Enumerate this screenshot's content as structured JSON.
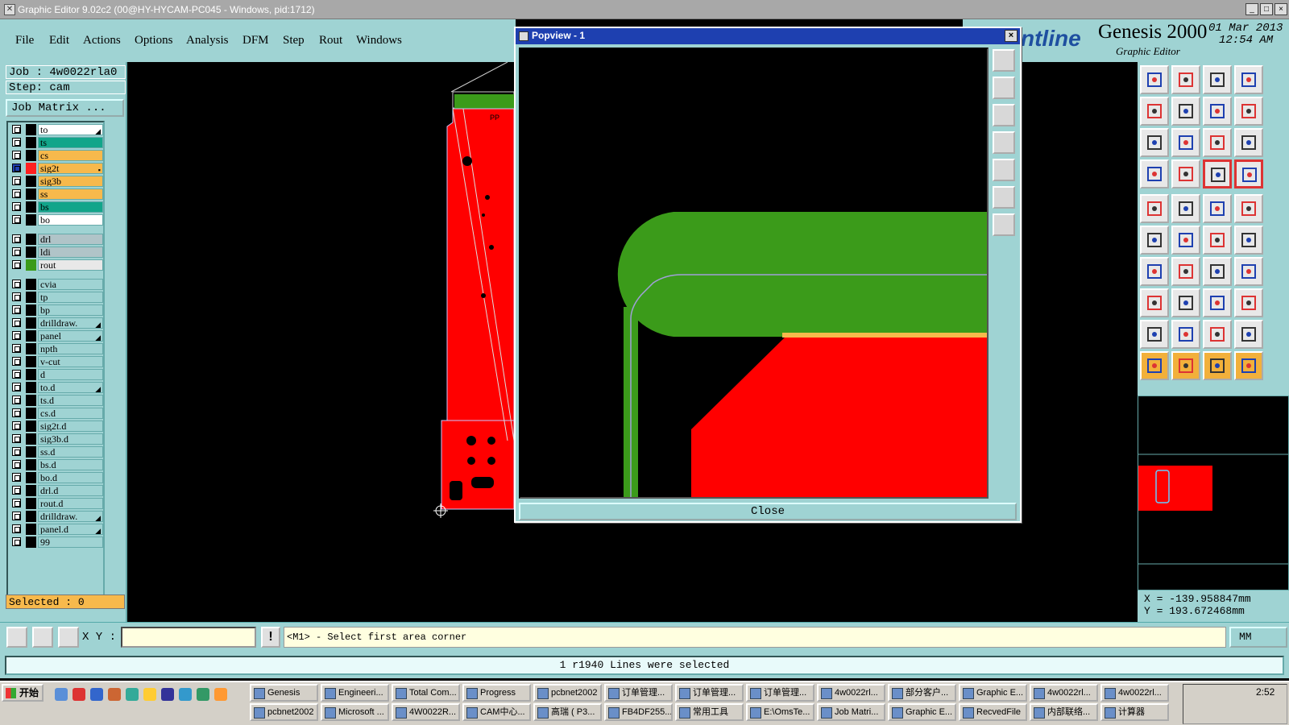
{
  "window": {
    "title": "Graphic Editor 9.02c2 (00@HY-HYCAM-PC045 - Windows, pid:1712)",
    "buttons": [
      "_",
      "□",
      "×"
    ]
  },
  "menu": [
    "File",
    "Edit",
    "Actions",
    "Options",
    "Analysis",
    "DFM",
    "Step",
    "Rout",
    "Windows"
  ],
  "brand": {
    "logo": "ntline",
    "product": "Genesis 2000",
    "subtitle": "Graphic Editor",
    "date": "01 Mar 2013",
    "time": "12:54 AM"
  },
  "job": {
    "job_line": "Job : 4w0022rla0",
    "step_line": "Step: cam",
    "matrix_button": "Job Matrix ..."
  },
  "layers": [
    {
      "name": "to",
      "color": "#ffffff",
      "swatch": "#000000",
      "mark": "◢"
    },
    {
      "name": "ts",
      "color": "#12a58a",
      "swatch": "#000000",
      "mark": ""
    },
    {
      "name": "cs",
      "color": "#f7b94c",
      "swatch": "#000000",
      "mark": ""
    },
    {
      "name": "sig2t",
      "color": "#f7b94c",
      "swatch": "#ff2020",
      "mark": "▪",
      "active": true
    },
    {
      "name": "sig3b",
      "color": "#f7b94c",
      "swatch": "#000000",
      "mark": ""
    },
    {
      "name": "ss",
      "color": "#f7b94c",
      "swatch": "#000000",
      "mark": ""
    },
    {
      "name": "bs",
      "color": "#12a58a",
      "swatch": "#000000",
      "mark": ""
    },
    {
      "name": "bo",
      "color": "#ffffff",
      "swatch": "#000000",
      "mark": ""
    },
    {
      "name": "drl",
      "color": "#b0c4c8",
      "swatch": "#000000",
      "mark": ""
    },
    {
      "name": "ldi",
      "color": "#b0c4c8",
      "swatch": "#000000",
      "mark": ""
    },
    {
      "name": "rout",
      "color": "#e8e8e8",
      "swatch": "#3b9b1a",
      "mark": ""
    },
    {
      "name": "cvia",
      "color": "#9fd3d3",
      "swatch": "#000000",
      "mark": ""
    },
    {
      "name": "tp",
      "color": "#9fd3d3",
      "swatch": "#000000",
      "mark": ""
    },
    {
      "name": "bp",
      "color": "#9fd3d3",
      "swatch": "#000000",
      "mark": ""
    },
    {
      "name": "drilldraw.",
      "color": "#9fd3d3",
      "swatch": "#000000",
      "mark": "◢"
    },
    {
      "name": "panel",
      "color": "#9fd3d3",
      "swatch": "#000000",
      "mark": "◢"
    },
    {
      "name": "npth",
      "color": "#9fd3d3",
      "swatch": "#000000",
      "mark": ""
    },
    {
      "name": "v-cut",
      "color": "#9fd3d3",
      "swatch": "#000000",
      "mark": ""
    },
    {
      "name": "d",
      "color": "#9fd3d3",
      "swatch": "#000000",
      "mark": ""
    },
    {
      "name": "to.d",
      "color": "#9fd3d3",
      "swatch": "#000000",
      "mark": "◢"
    },
    {
      "name": "ts.d",
      "color": "#9fd3d3",
      "swatch": "#000000",
      "mark": ""
    },
    {
      "name": "cs.d",
      "color": "#9fd3d3",
      "swatch": "#000000",
      "mark": ""
    },
    {
      "name": "sig2t.d",
      "color": "#9fd3d3",
      "swatch": "#000000",
      "mark": ""
    },
    {
      "name": "sig3b.d",
      "color": "#9fd3d3",
      "swatch": "#000000",
      "mark": ""
    },
    {
      "name": "ss.d",
      "color": "#9fd3d3",
      "swatch": "#000000",
      "mark": ""
    },
    {
      "name": "bs.d",
      "color": "#9fd3d3",
      "swatch": "#000000",
      "mark": ""
    },
    {
      "name": "bo.d",
      "color": "#9fd3d3",
      "swatch": "#000000",
      "mark": ""
    },
    {
      "name": "drl.d",
      "color": "#9fd3d3",
      "swatch": "#000000",
      "mark": ""
    },
    {
      "name": "rout.d",
      "color": "#9fd3d3",
      "swatch": "#000000",
      "mark": ""
    },
    {
      "name": "drilldraw.",
      "color": "#9fd3d3",
      "swatch": "#000000",
      "mark": "◢"
    },
    {
      "name": "panel.d",
      "color": "#9fd3d3",
      "swatch": "#000000",
      "mark": "◢"
    },
    {
      "name": "99",
      "color": "#9fd3d3",
      "swatch": "#000000",
      "mark": ""
    }
  ],
  "selected": "Selected : 0",
  "popview": {
    "title": "Popview - 1",
    "close_label": "Close"
  },
  "coords": {
    "x": "X = -139.958847mm",
    "y": "Y = 193.672468mm"
  },
  "cmd": {
    "xy_label": "X Y :",
    "xy_value": "",
    "warn": "!",
    "prompt": "<M1> - Select first area corner",
    "units": "MM"
  },
  "status": "1 r1940 Lines were selected",
  "colors": {
    "panel_bg": "#9fd3d3",
    "copper_red": "#ff0000",
    "green_layer": "#3b9b1a",
    "highlight_orange": "#f7b94c"
  },
  "taskbar": {
    "start": "开始",
    "row1": [
      "Genesis",
      "Engineeri...",
      "Total Com...",
      "Progress",
      "pcbnet2002",
      "订单管理...",
      "订单管理...",
      "订单管理...",
      "4w0022rl...",
      "部分客户...",
      "Graphic E...",
      "4w0022rl...",
      "4w0022rl..."
    ],
    "row2": [
      "pcbnet2002",
      "Microsoft ...",
      "4W0022R...",
      "CAM中心...",
      "高瑞 ( P3...",
      "FB4DF255...",
      "常用工具",
      "E:\\OmsTe...",
      "Job Matri...",
      "Graphic E...",
      "RecvedFile",
      "内部联络...",
      "计算器"
    ],
    "clock": "2:52"
  }
}
